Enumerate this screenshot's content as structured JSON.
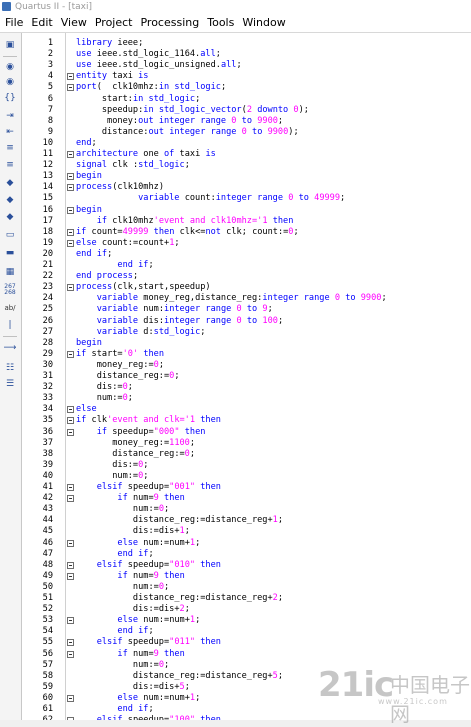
{
  "window": {
    "title": "Quartus II - [taxi]"
  },
  "menu": [
    "File",
    "Edit",
    "View",
    "Project",
    "Processing",
    "Tools",
    "Window"
  ],
  "toolbar": {
    "icons": [
      "open-file-icon",
      "find-icon",
      "find-next-icon",
      "brace-match-icon",
      "indent-icon",
      "unindent-icon",
      "comment-icon",
      "uncomment-icon",
      "bookmark-icon",
      "next-bookmark-icon",
      "prev-bookmark-icon",
      "insert-template-icon",
      "toggle-insert-icon",
      "line-numbers-icon",
      "insert-code-icon",
      "go-to-line-icon",
      "wrap-icon",
      "list-icon"
    ],
    "line_numbers_label_1": "267",
    "line_numbers_label_2": "268",
    "ab_label": "ab/"
  },
  "colors": {
    "keyword": "#0000ff",
    "number": "#ff00ff",
    "text": "#000000"
  },
  "code": {
    "lines": [
      {
        "n": "1",
        "fold": false,
        "t": "library ieee;"
      },
      {
        "n": "2",
        "fold": false,
        "t": "use ieee.std_logic_1164.all;"
      },
      {
        "n": "3",
        "fold": false,
        "t": "use ieee.std_logic_unsigned.all;"
      },
      {
        "n": "4",
        "fold": true,
        "t": "entity taxi is"
      },
      {
        "n": "5",
        "fold": true,
        "t": "port(  clk10mhz:in std_logic;"
      },
      {
        "n": "6",
        "fold": false,
        "t": "     start:in std_logic;"
      },
      {
        "n": "7",
        "fold": false,
        "t": "     speedup:in std_logic_vector(2 downto 0);"
      },
      {
        "n": "8",
        "fold": false,
        "t": "      money:out integer range 0 to 9900;"
      },
      {
        "n": "9",
        "fold": false,
        "t": "     distance:out integer range 0 to 9900);"
      },
      {
        "n": "10",
        "fold": false,
        "t": "end;"
      },
      {
        "n": "11",
        "fold": true,
        "t": "architecture one of taxi is"
      },
      {
        "n": "12",
        "fold": false,
        "t": "signal clk :std_logic;"
      },
      {
        "n": "13",
        "fold": true,
        "t": "begin"
      },
      {
        "n": "14",
        "fold": true,
        "t": "process(clk10mhz)"
      },
      {
        "n": "15",
        "fold": false,
        "t": "            variable count:integer range 0 to 49999;"
      },
      {
        "n": "16",
        "fold": true,
        "t": "begin"
      },
      {
        "n": "17",
        "fold": false,
        "t": "    if clk10mhz'event and clk10mhz='1' then"
      },
      {
        "n": "18",
        "fold": true,
        "t": "if count=49999 then clk<=not clk; count:=0;"
      },
      {
        "n": "19",
        "fold": true,
        "t": "else count:=count+1;"
      },
      {
        "n": "20",
        "fold": false,
        "t": "end if;"
      },
      {
        "n": "21",
        "fold": false,
        "t": "        end if;"
      },
      {
        "n": "22",
        "fold": false,
        "t": "end process;"
      },
      {
        "n": "23",
        "fold": true,
        "t": "process(clk,start,speedup)"
      },
      {
        "n": "24",
        "fold": false,
        "t": "    variable money_reg,distance_reg:integer range 0 to 9900;"
      },
      {
        "n": "25",
        "fold": false,
        "t": "    variable num:integer range 0 to 9;"
      },
      {
        "n": "26",
        "fold": false,
        "t": "    variable dis:integer range 0 to 100;"
      },
      {
        "n": "27",
        "fold": false,
        "t": "    variable d:std_logic;"
      },
      {
        "n": "28",
        "fold": false,
        "t": "begin"
      },
      {
        "n": "29",
        "fold": true,
        "t": "if start='0' then"
      },
      {
        "n": "30",
        "fold": false,
        "t": "    money_reg:=0;"
      },
      {
        "n": "31",
        "fold": false,
        "t": "    distance_reg:=0;"
      },
      {
        "n": "32",
        "fold": false,
        "t": "    dis:=0;"
      },
      {
        "n": "33",
        "fold": false,
        "t": "    num:=0;"
      },
      {
        "n": "34",
        "fold": true,
        "t": "else"
      },
      {
        "n": "35",
        "fold": true,
        "t": "if clk'event and clk='1' then"
      },
      {
        "n": "36",
        "fold": true,
        "t": "    if speedup=\"000\" then"
      },
      {
        "n": "37",
        "fold": false,
        "t": "       money_reg:=1100;"
      },
      {
        "n": "38",
        "fold": false,
        "t": "       distance_reg:=0;"
      },
      {
        "n": "39",
        "fold": false,
        "t": "       dis:=0;"
      },
      {
        "n": "40",
        "fold": false,
        "t": "       num:=0;"
      },
      {
        "n": "41",
        "fold": true,
        "t": "    elsif speedup=\"001\" then"
      },
      {
        "n": "42",
        "fold": true,
        "t": "        if num=9 then"
      },
      {
        "n": "43",
        "fold": false,
        "t": "           num:=0;"
      },
      {
        "n": "44",
        "fold": false,
        "t": "           distance_reg:=distance_reg+1;"
      },
      {
        "n": "45",
        "fold": false,
        "t": "           dis:=dis+1;"
      },
      {
        "n": "46",
        "fold": true,
        "t": "        else num:=num+1;"
      },
      {
        "n": "47",
        "fold": false,
        "t": "        end if;"
      },
      {
        "n": "48",
        "fold": true,
        "t": "    elsif speedup=\"010\" then"
      },
      {
        "n": "49",
        "fold": true,
        "t": "        if num=9 then"
      },
      {
        "n": "50",
        "fold": false,
        "t": "           num:=0;"
      },
      {
        "n": "51",
        "fold": false,
        "t": "           distance_reg:=distance_reg+2;"
      },
      {
        "n": "52",
        "fold": false,
        "t": "           dis:=dis+2;"
      },
      {
        "n": "53",
        "fold": true,
        "t": "        else num:=num+1;"
      },
      {
        "n": "54",
        "fold": false,
        "t": "        end if;"
      },
      {
        "n": "55",
        "fold": true,
        "t": "    elsif speedup=\"011\" then"
      },
      {
        "n": "56",
        "fold": true,
        "t": "        if num=9 then"
      },
      {
        "n": "57",
        "fold": false,
        "t": "           num:=0;"
      },
      {
        "n": "58",
        "fold": false,
        "t": "           distance_reg:=distance_reg+5;"
      },
      {
        "n": "59",
        "fold": false,
        "t": "           dis:=dis+5;"
      },
      {
        "n": "60",
        "fold": true,
        "t": "        else num:=num+1;"
      },
      {
        "n": "61",
        "fold": false,
        "t": "        end if;"
      },
      {
        "n": "62",
        "fold": true,
        "t": "    elsif speedup=\"100\" then"
      }
    ]
  },
  "watermark": {
    "logo": "21ic",
    "cn": "中国电子网",
    "url": "www.21ic.com"
  }
}
